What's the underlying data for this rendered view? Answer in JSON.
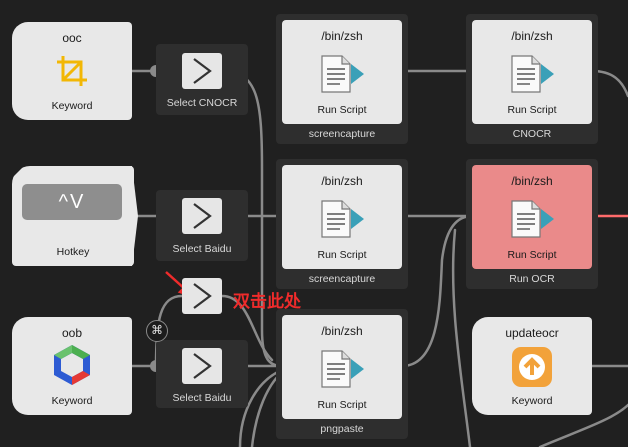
{
  "nodes": {
    "ooc": {
      "title": "ooc",
      "subtitle": "Keyword"
    },
    "hotkey": {
      "display": "^V",
      "subtitle": "Hotkey"
    },
    "oob": {
      "title": "oob",
      "subtitle": "Keyword"
    },
    "updateocr": {
      "title": "updateocr",
      "subtitle": "Keyword"
    }
  },
  "filters": {
    "select_cnocr": "Select CNOCR",
    "select_baidu_1": "Select Baidu",
    "select_baidu_2": "Select Baidu"
  },
  "scripts": {
    "screencapture_1": {
      "title": "/bin/zsh",
      "subtitle": "Run Script",
      "label": "screencapture"
    },
    "cnocr": {
      "title": "/bin/zsh",
      "subtitle": "Run Script",
      "label": "CNOCR"
    },
    "screencapture_2": {
      "title": "/bin/zsh",
      "subtitle": "Run Script",
      "label": "screencapture"
    },
    "run_ocr": {
      "title": "/bin/zsh",
      "subtitle": "Run Script",
      "label": "Run OCR"
    },
    "pngpaste": {
      "title": "/bin/zsh",
      "subtitle": "Run Script",
      "label": "pngpaste"
    }
  },
  "modifier_badge": "⌘",
  "annotation": "双击此处",
  "colors": {
    "canvas": "#202020",
    "node_bg": "#e8e8e8",
    "highlight": "#ea8a8a",
    "annotation": "#ef2b2b",
    "wire": "#8a8a8a",
    "active_wire": "#ff6b6b"
  }
}
